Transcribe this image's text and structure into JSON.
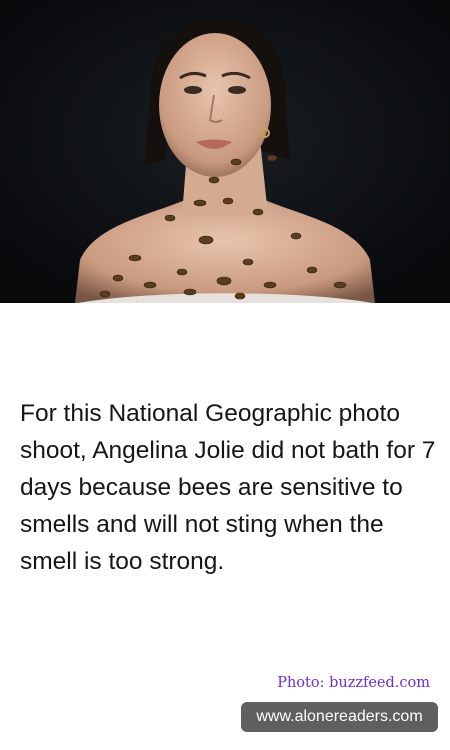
{
  "fact_text": "For this National Geographic photo shoot, Angelina Jolie did not bath for 7 days because bees are sensitive to smells and will not sting when the smell is too strong.",
  "photo_credit": "Photo: buzzfeed.com",
  "watermark": "www.alonereaders.com",
  "colors": {
    "photo_background": "#0b0d10",
    "credit": "#6a2fd6",
    "watermark_background": "#5f5f5f"
  }
}
